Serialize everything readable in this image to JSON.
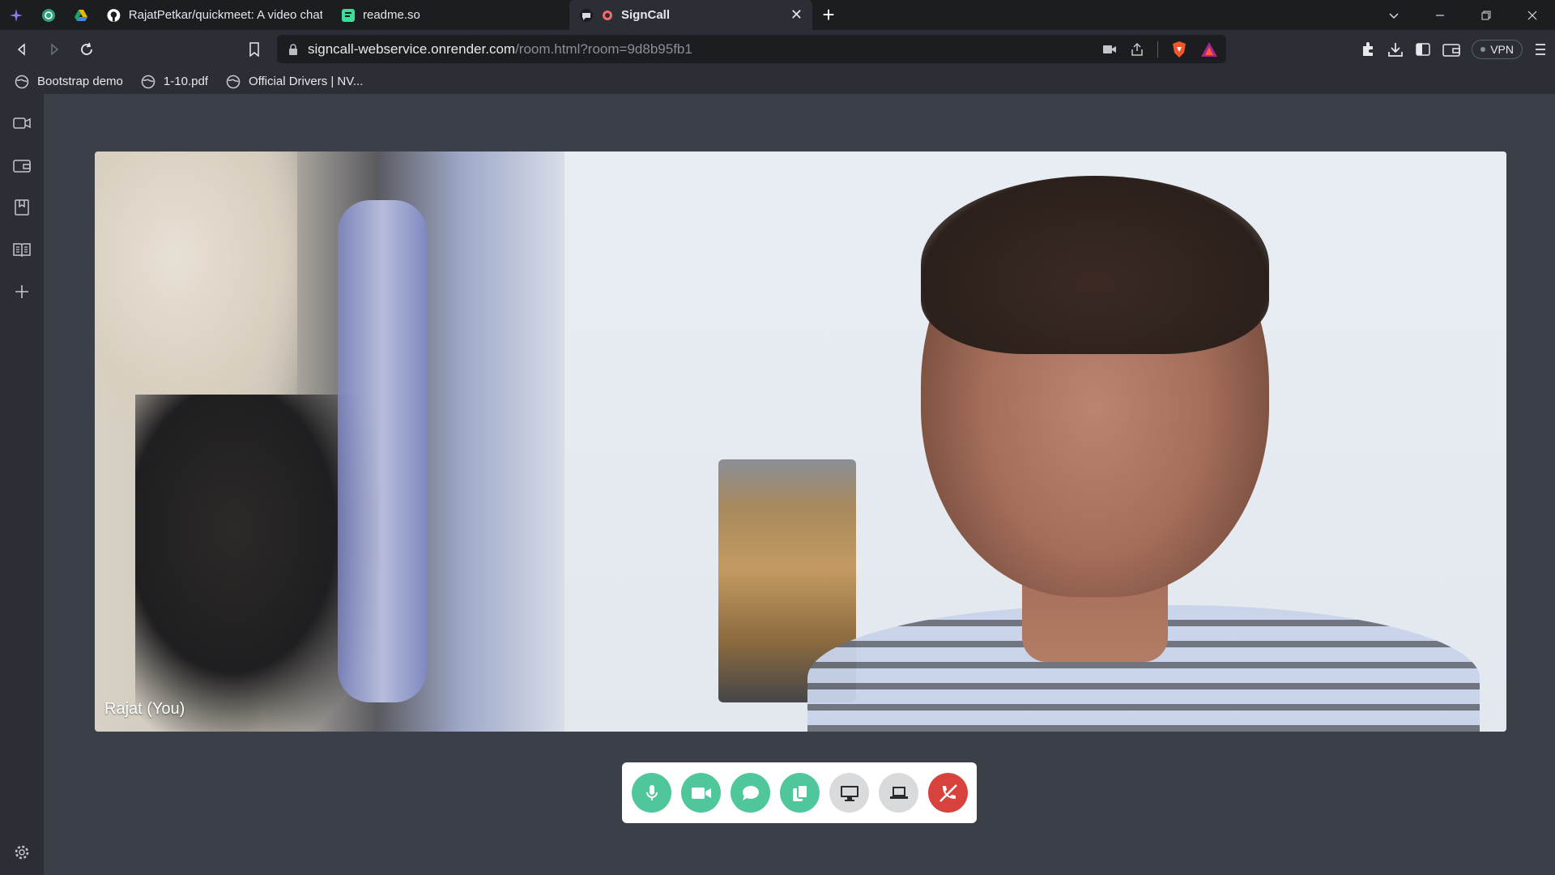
{
  "tabs": [
    {
      "title": "RajatPetkar/quickmeet: A video chat/m",
      "icon": "github-icon"
    },
    {
      "title": "readme.so",
      "icon": "readme-icon"
    },
    {
      "title": "SignCall",
      "icon": "signcall-icon",
      "active": true
    }
  ],
  "address": {
    "host": "signcall-webservice.onrender.com",
    "path": "/room.html?room=9d8b95fb1"
  },
  "toolbar": {
    "vpn_label": "VPN"
  },
  "bookmarks": [
    {
      "label": "Bootstrap demo"
    },
    {
      "label": "1-10.pdf"
    },
    {
      "label": "Official Drivers | NV..."
    }
  ],
  "video": {
    "participant_label": "Rajat (You)"
  },
  "call_controls": [
    {
      "name": "mic-button",
      "icon": "mic-icon",
      "color": "#4fc79a"
    },
    {
      "name": "camera-button",
      "icon": "video-camera-icon",
      "color": "#4fc79a"
    },
    {
      "name": "chat-button",
      "icon": "chat-bubble-icon",
      "color": "#4fc79a"
    },
    {
      "name": "copy-link-button",
      "icon": "copy-icon",
      "color": "#4fc79a"
    },
    {
      "name": "screen-share-button",
      "icon": "monitor-icon",
      "color": "#d9dadc"
    },
    {
      "name": "whiteboard-button",
      "icon": "laptop-icon",
      "color": "#d9dadc"
    },
    {
      "name": "end-call-button",
      "icon": "end-call-icon",
      "color": "#d8423c"
    }
  ],
  "colors": {
    "accent_green": "#4fc79a",
    "end_call_red": "#d8423c",
    "background": "#3a3f48"
  }
}
